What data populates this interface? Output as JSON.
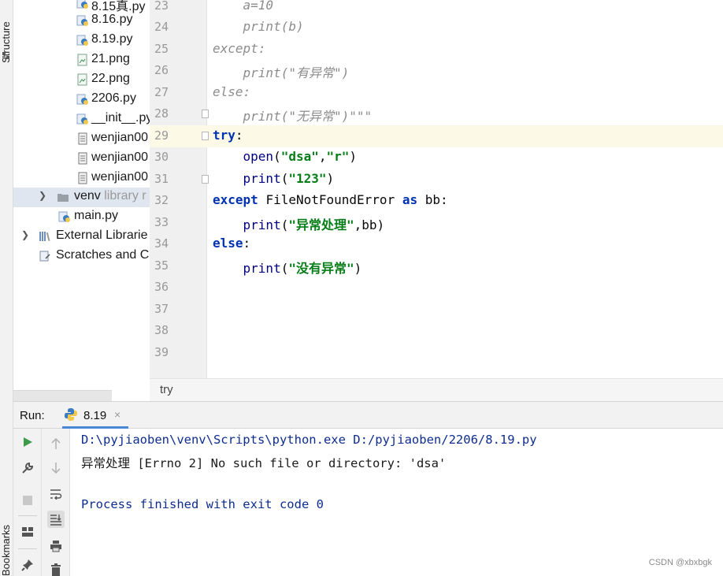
{
  "side_tabs": {
    "structure": "Structure",
    "bookmarks": "Bookmarks"
  },
  "project_tree": {
    "items": [
      {
        "label": "8.15真.py",
        "icon": "python-file-icon"
      },
      {
        "label": "8.16.py",
        "icon": "python-file-icon"
      },
      {
        "label": "8.19.py",
        "icon": "python-file-icon"
      },
      {
        "label": "21.png",
        "icon": "image-file-icon"
      },
      {
        "label": "22.png",
        "icon": "image-file-icon"
      },
      {
        "label": "2206.py",
        "icon": "python-file-icon"
      },
      {
        "label": "__init__.py",
        "icon": "python-file-icon"
      },
      {
        "label": "wenjian00",
        "icon": "text-file-icon"
      },
      {
        "label": "wenjian00",
        "icon": "text-file-icon"
      },
      {
        "label": "wenjian00",
        "icon": "text-file-icon"
      }
    ],
    "venv": {
      "label": "venv",
      "suffix": "library r",
      "icon": "folder-icon"
    },
    "main": {
      "label": "main.py",
      "icon": "python-file-icon"
    },
    "external": {
      "label": "External Librarie",
      "icon": "library-icon"
    },
    "scratches": {
      "label": "Scratches and Co",
      "icon": "scratches-icon"
    }
  },
  "editor": {
    "lines": [
      {
        "num": "23",
        "code": "    a=10"
      },
      {
        "num": "24",
        "code": "    print(b)"
      },
      {
        "num": "25",
        "code": "except:"
      },
      {
        "num": "26",
        "code": "    print(\"有异常\")"
      },
      {
        "num": "27",
        "code": "else:"
      },
      {
        "num": "28",
        "code": "    print(\"无异常\")\"\"\""
      },
      {
        "num": "29",
        "code": "try:"
      },
      {
        "num": "30",
        "code": "    open(\"dsa\",\"r\")"
      },
      {
        "num": "31",
        "code": "    print(\"123\")"
      },
      {
        "num": "32",
        "code": "except FileNotFoundError as bb:"
      },
      {
        "num": "33",
        "code": "    print(\"异常处理\",bb)"
      },
      {
        "num": "34",
        "code": "else:"
      },
      {
        "num": "35",
        "code": "    print(\"没有异常\")"
      },
      {
        "num": "36",
        "code": ""
      },
      {
        "num": "37",
        "code": ""
      },
      {
        "num": "38",
        "code": ""
      },
      {
        "num": "39",
        "code": ""
      }
    ],
    "current_line": "29",
    "breadcrumb": "try"
  },
  "run_panel": {
    "title": "Run:",
    "tab_label": "8.19",
    "close_glyph": "×",
    "output": [
      "D:\\pyjiaoben\\venv\\Scripts\\python.exe D:/pyjiaoben/2206/8.19.py",
      "异常处理 [Errno 2] No such file or directory: 'dsa'",
      "",
      "Process finished with exit code 0"
    ]
  },
  "watermark": "CSDN @xbxbgk",
  "colors": {
    "keyword": "#0033b3",
    "string": "#067d17",
    "comment": "#8c8c8c",
    "accent": "#4a87d6"
  }
}
